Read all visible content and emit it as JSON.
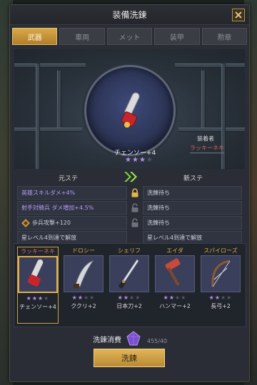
{
  "window": {
    "title": "装備洗鍊"
  },
  "tabs": [
    {
      "label": "武器",
      "active": true
    },
    {
      "label": "車両",
      "active": false
    },
    {
      "label": "メット",
      "active": false
    },
    {
      "label": "装甲",
      "active": false
    },
    {
      "label": "勲章",
      "active": false
    }
  ],
  "equipped": {
    "item_name": "チェンソー+4",
    "stars_on": 3,
    "stars_total": 4,
    "equipper_label": "装着者",
    "equipper_name": "ラッキーネキ"
  },
  "stats": {
    "old_label": "元ステ",
    "new_label": "新ステ",
    "rows": [
      {
        "old": "英雄スキルダメ+4%",
        "new": "洗錬待ち",
        "locked": true,
        "old_color": "purple"
      },
      {
        "old": "射手対騎兵 ダメ増加+4.5%",
        "new": "洗錬待ち",
        "locked": false,
        "old_color": "purple"
      },
      {
        "old": "歩兵攻撃+120",
        "new": "洗錬待ち",
        "locked": false,
        "old_color": "gray"
      },
      {
        "old": "星レベル4到達で解放",
        "new": "星レベル4到達で解放",
        "locked": false,
        "old_color": "gray"
      }
    ]
  },
  "characters": [
    {
      "name": "ラッキーネキ",
      "item": "チェンソー+4",
      "stars_on": 3,
      "stars_total": 4,
      "selected": true,
      "icon": "chainsaw-icon"
    },
    {
      "name": "ドロシー",
      "item": "ククリ+2",
      "stars_on": 2,
      "stars_total": 4,
      "selected": false,
      "icon": "kukri-icon"
    },
    {
      "name": "シェリフ",
      "item": "日本刀+2",
      "stars_on": 2,
      "stars_total": 4,
      "selected": false,
      "icon": "katana-icon"
    },
    {
      "name": "エイダ",
      "item": "ハンマー+2",
      "stars_on": 2,
      "stars_total": 4,
      "selected": false,
      "icon": "hammer-icon"
    },
    {
      "name": "スパイローズ",
      "item": "長弓+2",
      "stars_on": 2,
      "stars_total": 4,
      "selected": false,
      "icon": "bow-icon"
    }
  ],
  "cost": {
    "label": "洗鍊消費",
    "value": "455/40"
  },
  "action": {
    "label": "洗鍊"
  },
  "colors": {
    "accent": "#d4a548",
    "purple": "#b58cf0",
    "panel": "#2a2d35"
  }
}
